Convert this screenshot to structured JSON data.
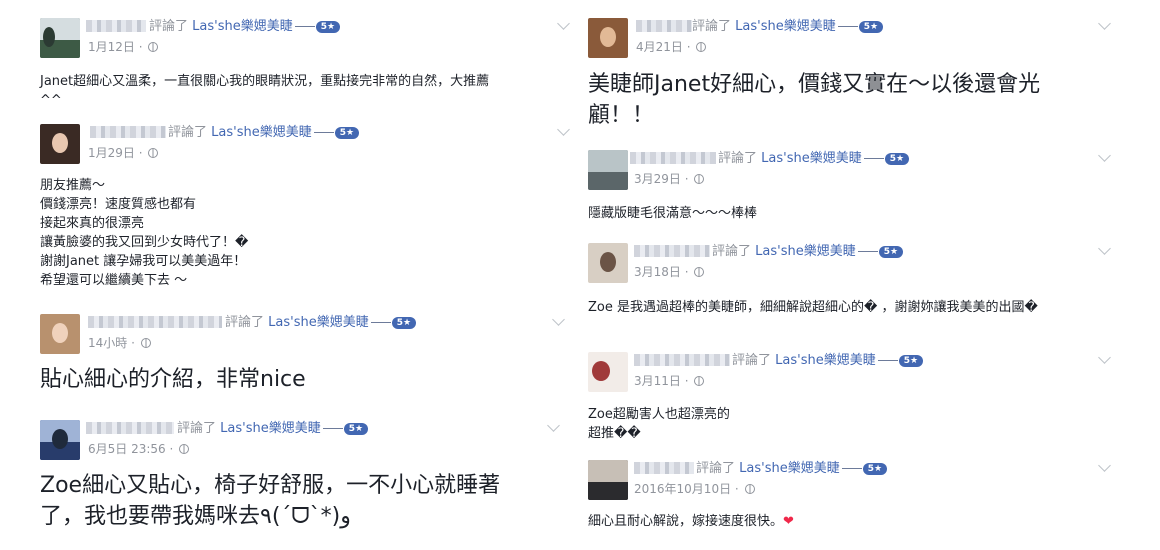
{
  "review_action": "評論了",
  "page_name": "Las'she樂媤美睫",
  "rating": "5★",
  "reviews": [
    {
      "date": "1月12日",
      "text": "Janet超細心又溫柔，一直很關心我的眼睛狀況，重點接完非常的自然，大推薦\n^^",
      "emoji": ""
    },
    {
      "date": "1月29日",
      "text": "朋友推薦～\n價錢漂亮！速度質感也都有\n接起來真的很漂亮\n讓黃臉婆的我又回到少女時代了！�\n謝謝Janet 讓孕婦我可以美美過年！\n希望還可以繼續美下去 ～",
      "emoji": ""
    },
    {
      "date": "14小時",
      "text": "貼心細心的介紹，非常nice",
      "emoji": ""
    },
    {
      "date": "6月5日 23:56",
      "text": "Zoe細心又貼心，椅子好舒服，一不小心就睡著\n了，我也要帶我媽咪去٩(ˊᗜˋ*)و",
      "emoji": ""
    },
    {
      "date": "4月21日",
      "text": "美睫師Janet好細心，價錢又實在～以後還會光\n顧！！",
      "emoji": ""
    },
    {
      "date": "3月29日",
      "text": "隱藏版睫毛很滿意～～～棒棒",
      "emoji": ""
    },
    {
      "date": "3月18日",
      "text": "Zoe 是我遇過超棒的美睫師，細細解說超細心的� ，謝謝妳讓我美美的出國�",
      "emoji": ""
    },
    {
      "date": "3月11日",
      "text": "Zoe超勵害人也超漂亮的\n超推��",
      "emoji": ""
    },
    {
      "date": "2016年10月10日",
      "text": "細心且耐心解說，嫁接速度很快。",
      "emoji": "❤"
    }
  ],
  "icons": {
    "avatar": "avatar-photo",
    "privacy": "globe-icon",
    "options": "chevron-down-icon"
  },
  "colors": {
    "page_link": "#4267b2",
    "meta": "#90949c",
    "heart": "#f0284a"
  }
}
